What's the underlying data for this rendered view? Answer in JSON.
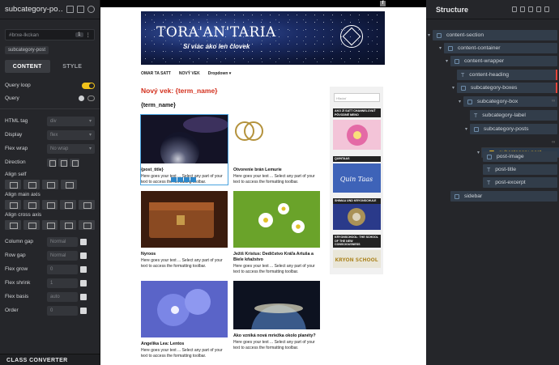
{
  "left_panel": {
    "title": "subcategory-po…",
    "selector": "#brxe-lkckan",
    "selector_count": "1",
    "class_chip": "subcategory-post",
    "tabs": [
      "CONTENT",
      "STYLE"
    ],
    "query_loop_label": "Query loop",
    "query_label": "Query",
    "props": {
      "html_tag": {
        "label": "HTML tag",
        "value": "div"
      },
      "display": {
        "label": "Display",
        "value": "flex"
      },
      "flex_wrap": {
        "label": "Flex wrap",
        "value": "No wrap"
      },
      "direction": {
        "label": "Direction"
      },
      "align_self": {
        "label": "Align self"
      },
      "align_main": {
        "label": "Align main axis"
      },
      "align_cross": {
        "label": "Align cross axis"
      },
      "column_gap": {
        "label": "Column gap",
        "value": "Normal"
      },
      "row_gap": {
        "label": "Row gap",
        "value": "Normal"
      },
      "flex_grow": {
        "label": "Flex grow",
        "value": "0"
      },
      "flex_shrink": {
        "label": "Flex shrink",
        "value": "1"
      },
      "flex_basis": {
        "label": "Flex basis",
        "value": "auto"
      },
      "order": {
        "label": "Order",
        "value": "0"
      }
    },
    "class_converter": "CLASS CONVERTER"
  },
  "canvas": {
    "fb_icon": "facebook-icon",
    "banner_title": "TORA'AN'TARIA",
    "banner_subtitle": "Si viac ako len človek",
    "nav": [
      "OMAR TA SATT",
      "NOVÝ VEK",
      "Dropdown ▾"
    ],
    "heading": "Nový vek: {term_name}",
    "term_label": "{term_name}",
    "posts": [
      {
        "title": "{post_title}",
        "excerpt": "Here goes your text ... Select any part of your text to access the formatting toolbar."
      },
      {
        "title": "Otvorenie brán Lemurie",
        "excerpt": "Here goes your text ... Select any part of your text to access the formatting toolbar."
      },
      {
        "title": "Nyroos",
        "excerpt": "Here goes your text ... Select any part of your text to access the formatting toolbar."
      },
      {
        "title": "Ježiš Kristus: Dedičstvo Kráľa Artuša a Biele kňažstvo",
        "excerpt": "Here goes your text ... Select any part of your text to access the formatting toolbar."
      },
      {
        "title": "Angelika Lea: Lentos",
        "excerpt": "Here goes your text ... Select any part of your text to access the formatting toolbar."
      },
      {
        "title": "Ako vzniká nová mriežka okolo planéty?",
        "excerpt": "Here goes your text ... Select any part of your text to access the formatting toolbar."
      }
    ],
    "sidebar": {
      "search_placeholder": "Hľadať",
      "items": [
        "AKO ZÍ SATT CHANNELOVAŤ PÔVODNÉ MENO",
        "QUINTAAS",
        "SHIMAA UND KRYONSCHULE",
        "KRYONSCHOOL: THE SCHOOL OF THE NEW CONSCIOUSNESS"
      ],
      "image_texts": [
        "Quin Taas",
        "KRYON SCHOOL"
      ]
    },
    "colors": {
      "heading": "#d32f1c",
      "selection": "#4aa3df"
    }
  },
  "structure": {
    "title": "Structure",
    "nodes": [
      "content-section",
      "content-container",
      "content-wrapper",
      "content-heading",
      "subcategory-boxes",
      "subcategory-box",
      "subcategory-label",
      "subcategory-posts",
      "subcategory-post",
      "post-image",
      "post-title",
      "post-excerpt",
      "sidebar"
    ]
  }
}
